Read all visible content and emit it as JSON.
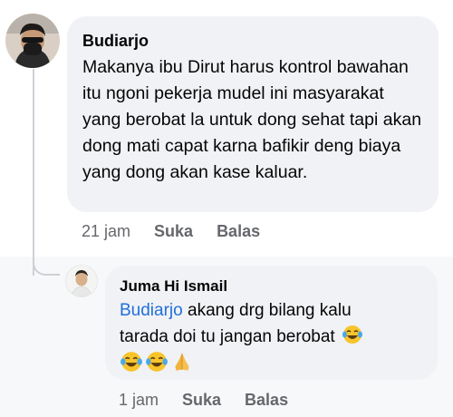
{
  "comment": {
    "author": "Budiarjo",
    "text": "Makanya ibu Dirut harus kontrol bawahan itu ngoni pekerja mudel ini masyarakat yang berobat la untuk dong sehat tapi akan dong mati capat karna bafikir deng biaya yang dong akan kase kaluar.",
    "time": "21 jam",
    "like_label": "Suka",
    "reply_label": "Balas"
  },
  "reply": {
    "author": "Juma Hi Ismail",
    "mention": "Budiarjo",
    "text_line1": "akang drg bilang kalu",
    "text_line2": "tarada doi tu jangan berobat",
    "emojis": [
      "face-with-tears-of-joy",
      "face-with-tears-of-joy",
      "face-with-tears-of-joy",
      "folded-hands"
    ],
    "time": "1 jam",
    "like_label": "Suka",
    "reply_label": "Balas"
  }
}
